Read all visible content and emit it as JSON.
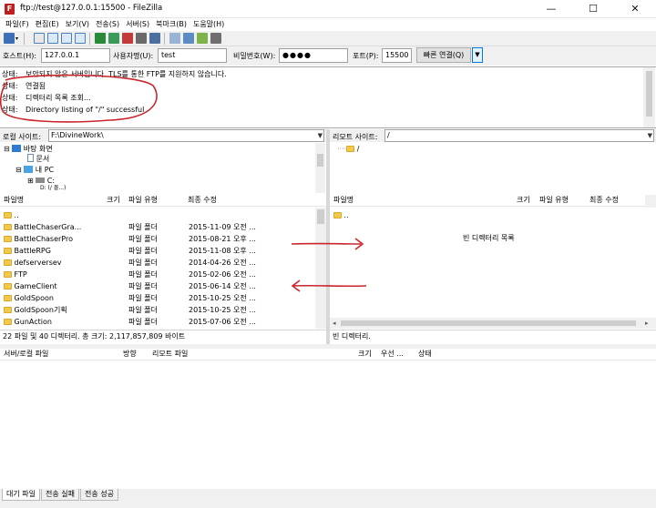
{
  "window": {
    "title": "ftp://test@127.0.0.1:15500 - FileZilla",
    "app_icon_letter": "F",
    "minimize": "—",
    "maximize": "☐",
    "close": "✕"
  },
  "menu": [
    "파일(F)",
    "편집(E)",
    "보기(V)",
    "전송(S)",
    "서버(S)",
    "북마크(B)",
    "도움말(H)"
  ],
  "quickconnect": {
    "host_label": "호스트(H):",
    "host_value": "127.0.0.1",
    "user_label": "사용자명(U):",
    "user_value": "test",
    "pass_label": "비밀번호(W):",
    "pass_value": "●●●●",
    "port_label": "포트(P):",
    "port_value": "15500",
    "connect_button": "빠른 연결(Q)",
    "dropdown_arrow": "▼"
  },
  "log": [
    {
      "label": "상태:",
      "text": "보안되지 않은 서버입니다. TLS를 통한 FTP를 지원하지 않습니다."
    },
    {
      "label": "상태:",
      "text": "연결됨"
    },
    {
      "label": "상태:",
      "text": "디렉터리 목록 조회..."
    },
    {
      "label": "상태:",
      "text": "Directory listing of \"/\" successful"
    }
  ],
  "local": {
    "site_label": "로컬 사이트:",
    "site_path": "F:\\DivineWork\\",
    "tree": [
      {
        "expander": "⊟",
        "label": "바탕 화면"
      },
      {
        "expander": "",
        "label": "문서"
      },
      {
        "expander": "⊟",
        "label": "내 PC"
      },
      {
        "expander": "⊞",
        "label": "C:"
      },
      {
        "expander": "",
        "label": "D: (/ 볼...)"
      }
    ],
    "columns": {
      "name": "파일명",
      "size": "크기",
      "type": "파일 유형",
      "modified": "최종 수정"
    },
    "files": [
      {
        "name": "..",
        "type": "",
        "modified": ""
      },
      {
        "name": "BattleChaserGra...",
        "type": "파일 폴더",
        "modified": "2015-11-09 오전 ..."
      },
      {
        "name": "BattleChaserPro",
        "type": "파일 폴더",
        "modified": "2015-08-21 오후 ..."
      },
      {
        "name": "BattleRPG",
        "type": "파일 폴더",
        "modified": "2015-11-08 오후 ..."
      },
      {
        "name": "defserversev",
        "type": "파일 폴더",
        "modified": "2014-04-26 오전 ..."
      },
      {
        "name": "FTP",
        "type": "파일 폴더",
        "modified": "2015-02-06 오전 ..."
      },
      {
        "name": "GameClient",
        "type": "파일 폴더",
        "modified": "2015-06-14 오전 ..."
      },
      {
        "name": "GoldSpoon",
        "type": "파일 폴더",
        "modified": "2015-10-25 오전 ..."
      },
      {
        "name": "GoldSpoon기획",
        "type": "파일 폴더",
        "modified": "2015-10-25 오전 ..."
      },
      {
        "name": "GunAction",
        "type": "파일 폴더",
        "modified": "2015-07-06 오전 ..."
      }
    ],
    "status": "22 파일 및 40 디렉터리. 총 크기: 2,117,857,809 바이트"
  },
  "remote": {
    "site_label": "리모트 사이트:",
    "site_path": "/",
    "tree": [
      {
        "label": "/"
      }
    ],
    "columns": {
      "name": "파일명",
      "size": "크기",
      "type": "파일 유형",
      "modified": "최종 수정"
    },
    "files": [
      {
        "name": ".."
      }
    ],
    "empty_text": "빈 디렉터리 목록",
    "status": "빈 디렉터리."
  },
  "queue": {
    "columns": {
      "server": "서버/로컬 파일",
      "direction": "방향",
      "remote": "리모트 파일",
      "size": "크기",
      "priority": "우선 ...",
      "status": "상태"
    },
    "tabs": [
      "대기 파일",
      "전송 실패",
      "전송 성공"
    ]
  },
  "colors": {
    "annotation_red": "#c9252b",
    "folder_yellow": "#f2c94c",
    "accent_blue": "#0078d7"
  }
}
